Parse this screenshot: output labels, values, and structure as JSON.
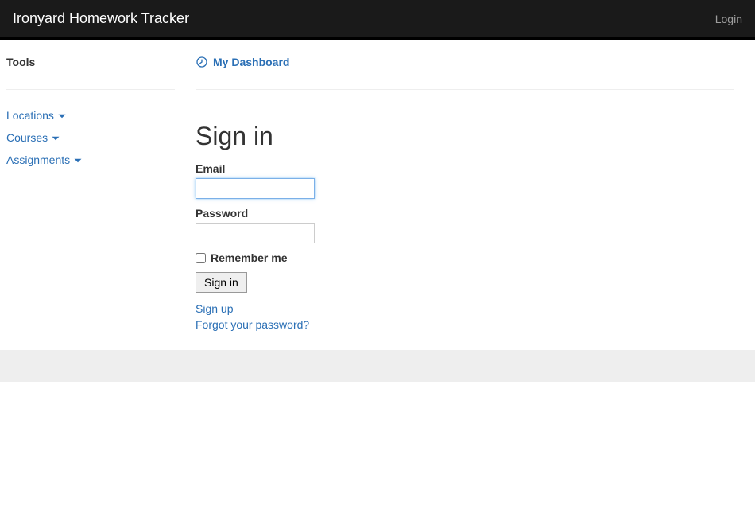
{
  "navbar": {
    "brand": "Ironyard Homework Tracker",
    "login": "Login"
  },
  "sidebar": {
    "title": "Tools",
    "items": [
      {
        "label": "Locations"
      },
      {
        "label": "Courses"
      },
      {
        "label": "Assignments"
      }
    ]
  },
  "main": {
    "dashboard_link": "My Dashboard",
    "signin": {
      "heading": "Sign in",
      "email_label": "Email",
      "email_value": "",
      "password_label": "Password",
      "password_value": "",
      "remember_label": "Remember me",
      "submit_label": "Sign in",
      "signup_link": "Sign up",
      "forgot_link": "Forgot your password?"
    }
  }
}
